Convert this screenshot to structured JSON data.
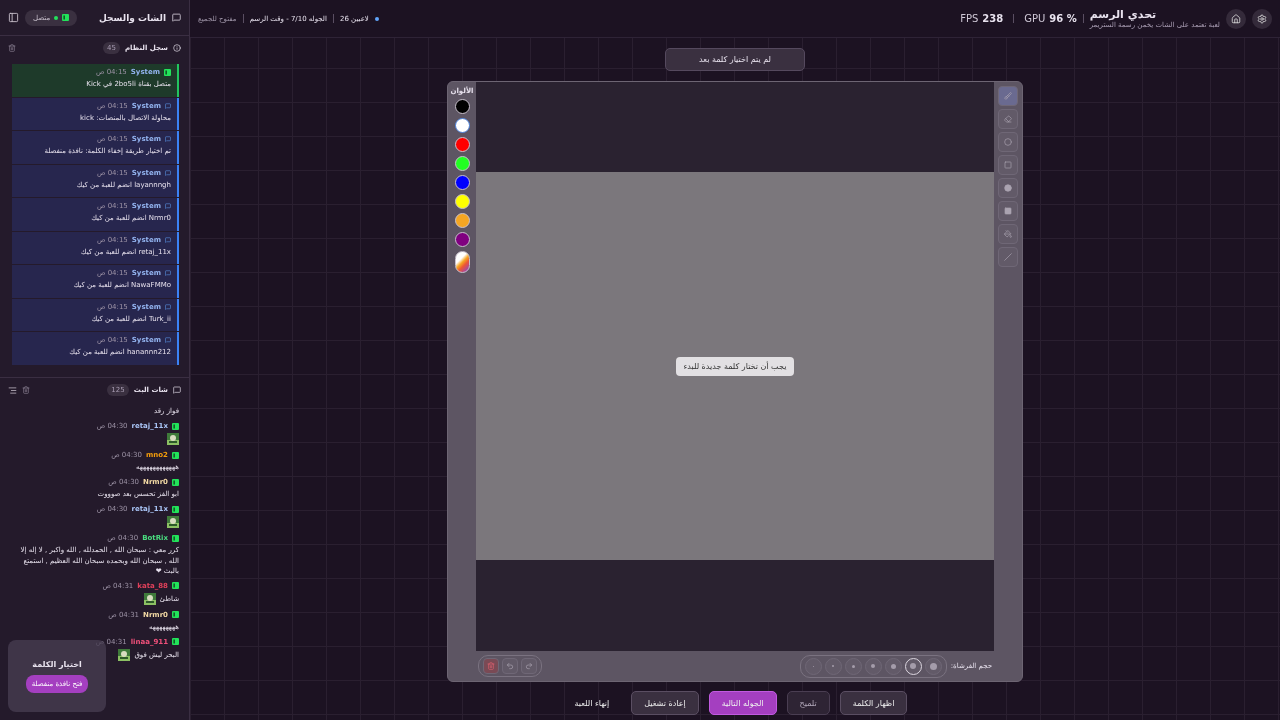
{
  "sidebar": {
    "title": "الشات والسجل",
    "connection": {
      "label": "متصل",
      "connected": true
    },
    "system_log": {
      "title": "سجل النظام",
      "count": "45",
      "entries": [
        {
          "author": "System",
          "time": "04:15 ص",
          "text": "متصل بقناة 2bo5li في Kick",
          "color": "#22c55e"
        },
        {
          "author": "System",
          "time": "04:15 ص",
          "text": "محاولة الاتصال بالمنصات: kick",
          "color": "#3b82f6"
        },
        {
          "author": "System",
          "time": "04:15 ص",
          "text": "تم اختيار طريقة إخفاء الكلمة: نافذة منفصلة",
          "color": "#3b82f6"
        },
        {
          "author": "System",
          "time": "04:15 ص",
          "text": "layannngh انضم للعبة من كيك",
          "color": "#3b82f6"
        },
        {
          "author": "System",
          "time": "04:15 ص",
          "text": "Nrmr0 انضم للعبة من كيك",
          "color": "#3b82f6"
        },
        {
          "author": "System",
          "time": "04:15 ص",
          "text": "retaj_11x انضم للعبة من كيك",
          "color": "#3b82f6"
        },
        {
          "author": "System",
          "time": "04:15 ص",
          "text": "NawaFMMo انضم للعبة من كيك",
          "color": "#3b82f6"
        },
        {
          "author": "System",
          "time": "04:15 ص",
          "text": "Turk_ii انضم للعبة من كيك",
          "color": "#3b82f6"
        },
        {
          "author": "System",
          "time": "04:15 ص",
          "text": "hanannn212 انضم للعبة من كيك",
          "color": "#3b82f6"
        }
      ]
    },
    "stream_chat": {
      "title": "شات البث",
      "count": "125",
      "messages": [
        {
          "kind": "text",
          "text": "فواز رقد"
        },
        {
          "kind": "emote",
          "author": "retaj_11x",
          "time": "04:30 ص",
          "color": "#a9c4f5"
        },
        {
          "kind": "text",
          "author": "mno2",
          "time": "04:30 ص",
          "color": "#f59e0b",
          "text": "ههههههههههههه"
        },
        {
          "kind": "text",
          "author": "Nrmr0",
          "time": "04:30 ص",
          "color": "#f3d9a4",
          "text": "ابو الفز تحسس بعد صوووت"
        },
        {
          "kind": "emote",
          "author": "retaj_11x",
          "time": "04:30 ص",
          "color": "#a9c4f5"
        },
        {
          "kind": "text",
          "author": "BotRix",
          "time": "04:30 ص",
          "color": "#4ade80",
          "text": "كرر معي : سبحان الله , الحمدلله , الله واكبر , لا إله إلا الله , سبحان الله وبحمده سبحان الله العظيم , استمتع بالبث ❤"
        },
        {
          "kind": "emote_text",
          "author": "kata_88",
          "time": "04:31 ص",
          "color": "#e0405a",
          "text": "شاطئ"
        },
        {
          "kind": "text",
          "author": "Nrmr0",
          "time": "04:31 ص",
          "color": "#f3d9a4",
          "text": "ههههههههه"
        },
        {
          "kind": "emote_text",
          "author": "linaa_911",
          "time": "04:31 ص",
          "color": "#f0507a",
          "text": "البحر ليش فوق"
        }
      ]
    }
  },
  "word_popup": {
    "title": "اختيار الكلمة",
    "button": "فتح نافذة منفصلة"
  },
  "header": {
    "players": "26 لاعبين",
    "round": "الجوله 7/10 - وقت الرسم",
    "access": "مفتوح للجميع",
    "title": "تحدي الرسم",
    "subtitle": "لعبة تعتمد على الشات يخمن رسمة الستريمر",
    "stats": [
      {
        "label": "GPU",
        "value": "96 %"
      },
      {
        "label": "FPS",
        "value": "238"
      }
    ]
  },
  "word_status": "لم يتم اختيار كلمة بعد",
  "canvas": {
    "palette_title": "الألوان",
    "colors": [
      {
        "color": "#000000",
        "selected": false
      },
      {
        "color": "#ffffff",
        "selected": true
      },
      {
        "color": "#ff0000",
        "selected": false
      },
      {
        "color": "#22ff22",
        "selected": false
      },
      {
        "color": "#0000ff",
        "selected": false
      },
      {
        "color": "#ffff00",
        "selected": false
      },
      {
        "color": "#f5a623",
        "selected": false
      },
      {
        "color": "#800080",
        "selected": false
      }
    ],
    "message": "يجب أن تختار كلمة جديدة للبدء",
    "tools": [
      {
        "kind": "brush",
        "selected": true
      },
      {
        "kind": "eraser",
        "selected": false
      },
      {
        "kind": "circle",
        "selected": false
      },
      {
        "kind": "rect",
        "selected": false
      },
      {
        "kind": "filled_circle",
        "selected": false
      },
      {
        "kind": "filled_rect",
        "selected": false
      },
      {
        "kind": "fill",
        "selected": false
      },
      {
        "kind": "line",
        "selected": false
      }
    ],
    "brush_size_label": "حجم الفرشاة:",
    "brush_sizes": [
      {
        "selected": false
      },
      {
        "selected": false
      },
      {
        "selected": false
      },
      {
        "selected": false
      },
      {
        "selected": false
      },
      {
        "selected": true
      },
      {
        "selected": false
      }
    ]
  },
  "buttons": [
    {
      "label": "اظهار الكلمة",
      "kind": "secondary"
    },
    {
      "label": "تلميح",
      "kind": "muted"
    },
    {
      "label": "الجوله التالية",
      "kind": "primary"
    },
    {
      "label": "إعادة تشغيل",
      "kind": "secondary"
    },
    {
      "label": "إنهاء اللعبة",
      "kind": "plain"
    }
  ]
}
